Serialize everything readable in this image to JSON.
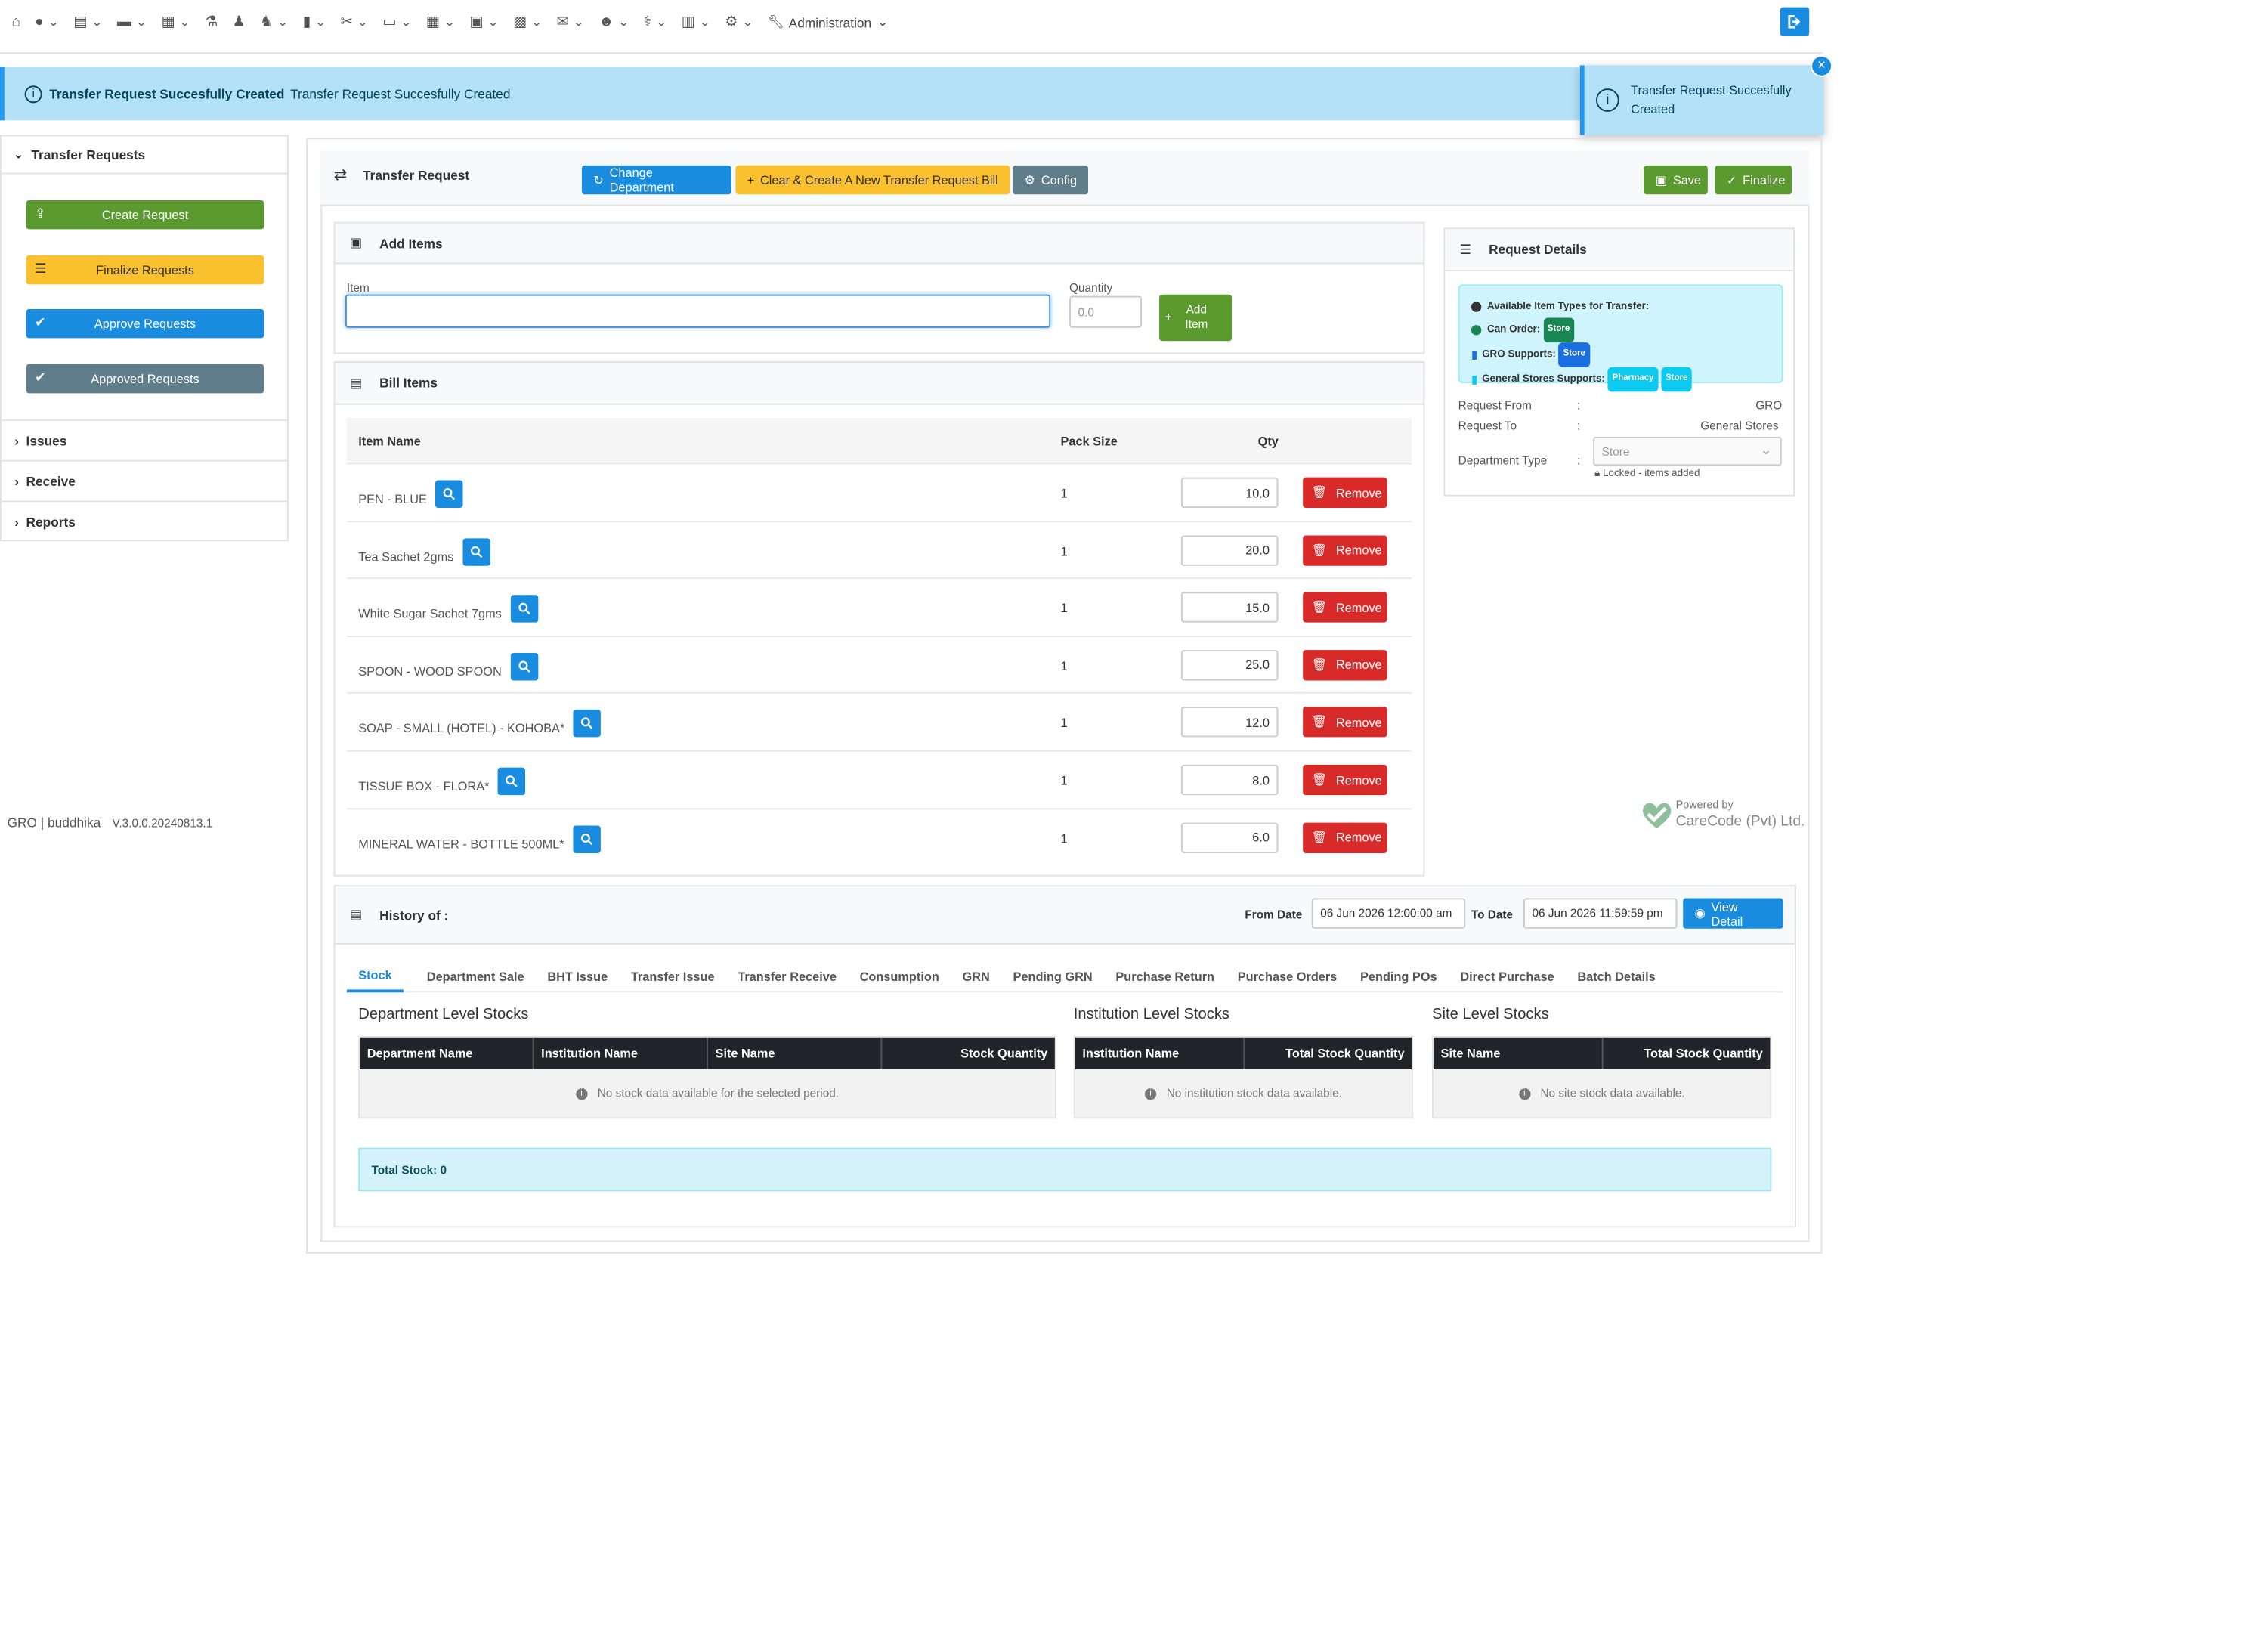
{
  "nav": {
    "admin_label": "Administration",
    "icons": [
      "home-icon",
      "user-icon",
      "id-card-icon",
      "bed-icon",
      "building-icon",
      "flask-icon",
      "user-doctor-icon",
      "person-chair-icon",
      "pill-bottle-icon",
      "scissors-icon",
      "archive-box-icon",
      "calendar-icon",
      "box-open-icon",
      "money-icon",
      "envelope-icon",
      "users-icon",
      "stethoscope-icon",
      "chart-icon",
      "gear-icon"
    ]
  },
  "alert": {
    "title": "Transfer Request Succesfully Created",
    "detail": "Transfer Request Succesfully Created"
  },
  "toast": {
    "message": "Transfer Request Succesfully Created",
    "close": "×"
  },
  "sidebar": {
    "section": "Transfer Requests",
    "buttons": [
      "Create Request",
      "Finalize Requests",
      "Approve Requests",
      "Approved Requests"
    ],
    "sections": [
      "Issues",
      "Receive",
      "Reports"
    ]
  },
  "footer": {
    "user": "GRO | buddhika",
    "version": "V.3.0.0.20240813.1",
    "powered": "Powered by",
    "company": "CareCode (Pvt) Ltd."
  },
  "panel": {
    "title": "Transfer Request",
    "change_dept": "Change Department",
    "clear_create": "Clear & Create A New Transfer Request Bill",
    "config": "Config",
    "save": "Save",
    "finalize": "Finalize"
  },
  "add_items": {
    "title": "Add Items",
    "item_label": "Item",
    "item_value": "",
    "qty_label": "Quantity",
    "qty_placeholder": "0.0",
    "add_btn": "Add Item"
  },
  "bill": {
    "title": "Bill Items",
    "headers": [
      "Item Name",
      "Pack Size",
      "Qty"
    ],
    "remove_label": "Remove",
    "rows": [
      {
        "name": "PEN - BLUE",
        "pack": "1",
        "qty": "10.0"
      },
      {
        "name": "Tea Sachet 2gms",
        "pack": "1",
        "qty": "20.0"
      },
      {
        "name": "White Sugar Sachet 7gms",
        "pack": "1",
        "qty": "15.0"
      },
      {
        "name": "SPOON - WOOD SPOON",
        "pack": "1",
        "qty": "25.0"
      },
      {
        "name": "SOAP - SMALL (HOTEL) - KOHOBA*",
        "pack": "1",
        "qty": "12.0"
      },
      {
        "name": "TISSUE BOX - FLORA*",
        "pack": "1",
        "qty": "8.0"
      },
      {
        "name": "MINERAL WATER - BOTTLE 500ML*",
        "pack": "1",
        "qty": "6.0"
      }
    ]
  },
  "details": {
    "title": "Request Details",
    "info_title": "Available Item Types for Transfer:",
    "can_order": "Can Order:",
    "can_order_badge": "Store",
    "gro_supports": "GRO Supports:",
    "gro_badge": "Store",
    "gs_supports": "General Stores Supports:",
    "gs_badges": [
      "Pharmacy",
      "Store"
    ],
    "request_from_label": "Request From",
    "request_from": "GRO",
    "request_to_label": "Request To",
    "request_to": "General Stores",
    "dept_type_label": "Department Type",
    "dept_type": "Store",
    "locked": "Locked - items added",
    "colon": ":"
  },
  "history": {
    "title": "History of :",
    "from_label": "From Date",
    "from": "06 Jun 2026 12:00:00 am",
    "to_label": "To Date",
    "to": "06 Jun 2026 11:59:59 pm",
    "view": "View Detail",
    "tabs": [
      "Stock",
      "Department Sale",
      "BHT Issue",
      "Transfer Issue",
      "Transfer Receive",
      "Consumption",
      "GRN",
      "Pending GRN",
      "Purchase Return",
      "Purchase Orders",
      "Pending POs",
      "Direct Purchase",
      "Batch Details"
    ],
    "dept_title": "Department Level Stocks",
    "dept_headers": [
      "Department Name",
      "Institution Name",
      "Site Name",
      "Stock Quantity"
    ],
    "dept_empty": "No stock data available for the selected period.",
    "inst_title": "Institution Level Stocks",
    "inst_headers": [
      "Institution Name",
      "Total Stock Quantity"
    ],
    "inst_empty": "No institution stock data available.",
    "site_title": "Site Level Stocks",
    "site_headers": [
      "Site Name",
      "Total Stock Quantity"
    ],
    "site_empty": "No site stock data available.",
    "total": "Total Stock: 0"
  },
  "colors": {
    "primary": "#1a8ce0",
    "success": "#5b9a2e",
    "warning": "#fbc02d",
    "danger": "#d92a2a",
    "secondary": "#607d8b"
  }
}
